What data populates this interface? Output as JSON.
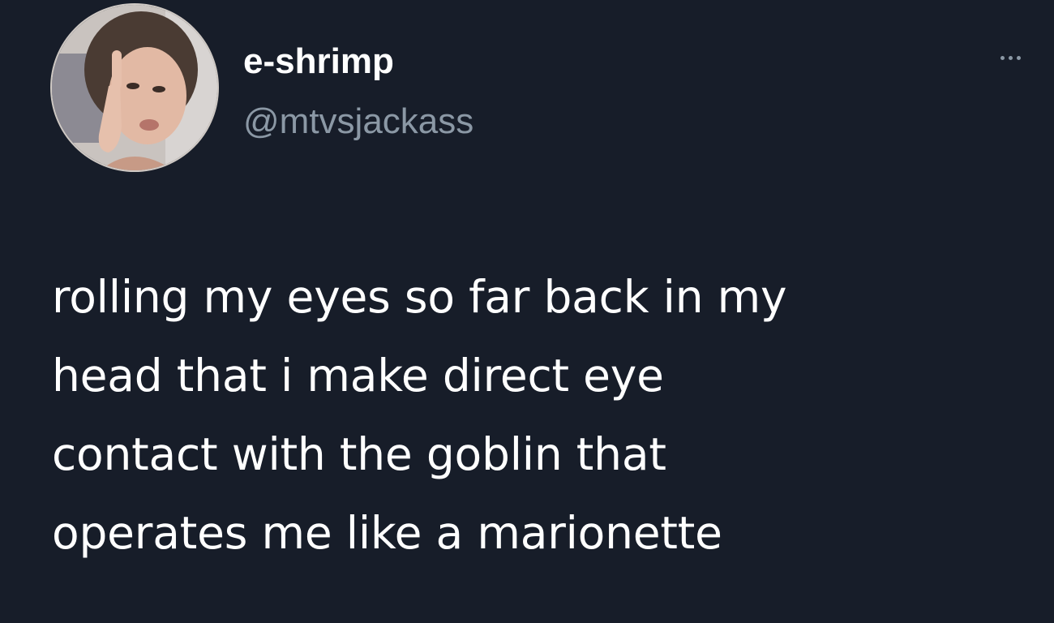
{
  "tweet": {
    "author": {
      "display_name": "e-shrimp",
      "handle": "@mtvsjackass",
      "avatar_icon": "profile-photo"
    },
    "more_icon": "more-options-icon",
    "text_lines": [
      "rolling my eyes so far back in my",
      "head that i make direct eye",
      "contact with the goblin that",
      "operates me like a marionette"
    ]
  },
  "colors": {
    "background": "#171d29",
    "primary_text": "#ffffff",
    "secondary_text": "#8b98a5"
  }
}
